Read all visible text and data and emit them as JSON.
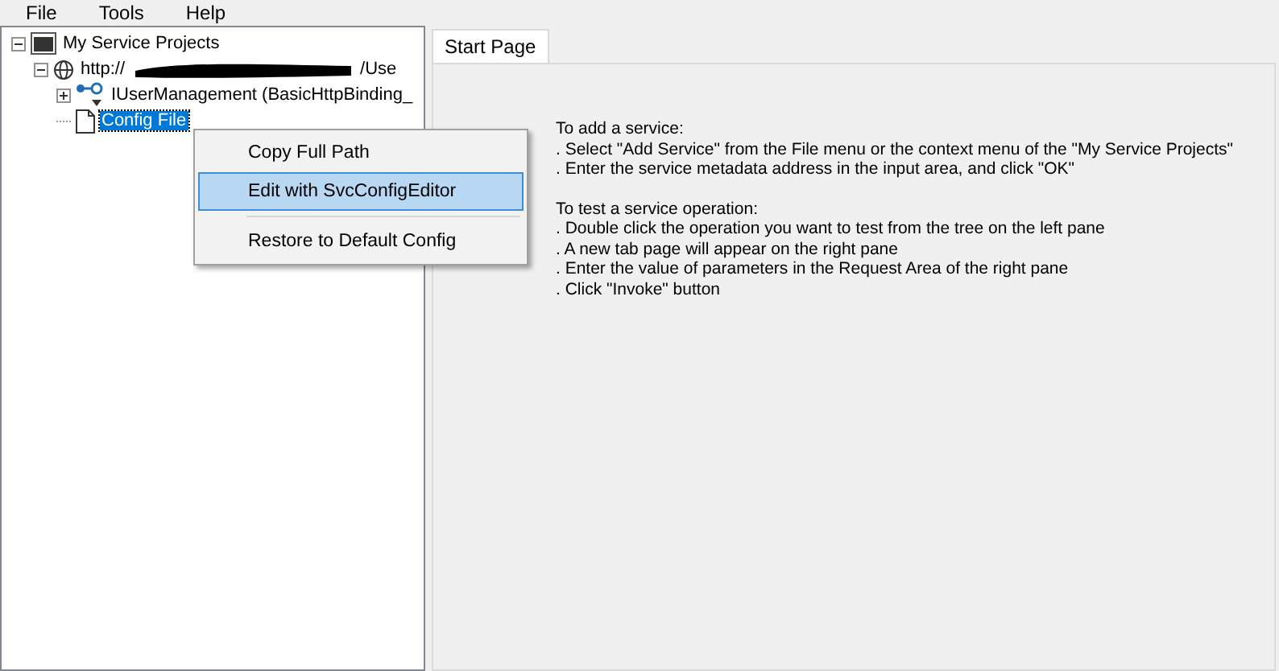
{
  "menu_bar": {
    "items": [
      "File",
      "Tools",
      "Help"
    ]
  },
  "tree": {
    "items": [
      {
        "kind": "project",
        "label": "My Service Projects",
        "expanded": true,
        "selected": false,
        "children": [
          {
            "kind": "endpoint",
            "label": "http://",
            "label_end": "/Use",
            "expanded": true,
            "selected": false,
            "children": [
              {
                "kind": "interface",
                "label": "IUserManagement (BasicHttpBinding_",
                "expanded": false,
                "selected": false
              },
              {
                "kind": "file",
                "label": "Config File",
                "selected": true
              }
            ]
          }
        ]
      }
    ]
  },
  "context_menu": {
    "items": [
      {
        "label": "Copy Full Path",
        "selected": false
      },
      {
        "label": "Edit with SvcConfigEditor",
        "selected": true
      },
      {
        "kind": "separator"
      },
      {
        "label": "Restore to Default Config",
        "selected": false
      }
    ]
  },
  "tabs": [
    {
      "label": "Start Page",
      "selected": true
    }
  ],
  "start_page": {
    "sections": [
      {
        "heading": "To add a service:",
        "steps": [
          ". Select \"Add Service\" from the File menu or the context menu of the \"My Service Projects\"",
          ". Enter the service metadata address in the input area, and click \"OK\""
        ]
      },
      {
        "heading": "To test a service operation:",
        "steps": [
          ". Double click the operation you want to test from the tree on the left pane",
          ". A new tab page will appear on the right pane",
          ". Enter the value of parameters in the Request Area of the right pane",
          ". Click \"Invoke\" button"
        ]
      }
    ]
  }
}
